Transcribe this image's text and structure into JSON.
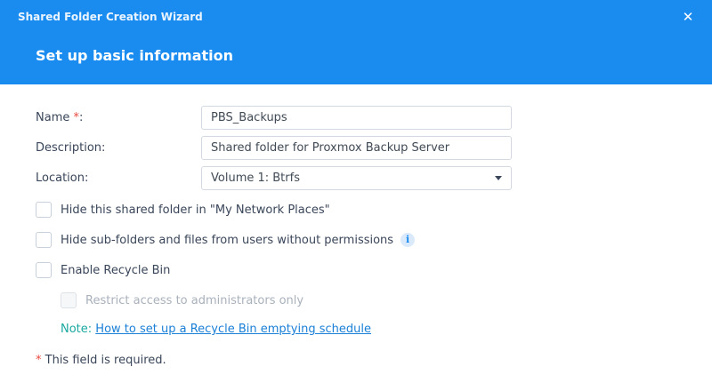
{
  "window": {
    "title": "Shared Folder Creation Wizard",
    "close_glyph": "✕"
  },
  "step": {
    "title": "Set up basic information"
  },
  "form": {
    "name": {
      "label": "Name ",
      "required_mark": "*",
      "suffix": ":",
      "value": "PBS_Backups"
    },
    "description": {
      "label": "Description:",
      "value": "Shared folder for Proxmox Backup Server"
    },
    "location": {
      "label": "Location:",
      "selected": "Volume 1:  Btrfs"
    }
  },
  "options": {
    "hide_folder": {
      "label": "Hide this shared folder in \"My Network Places\"",
      "checked": false
    },
    "hide_subfolders": {
      "label": "Hide sub-folders and files from users without permissions",
      "checked": false,
      "info_glyph": "i"
    },
    "recycle_bin": {
      "label": "Enable Recycle Bin",
      "checked": false
    },
    "restrict_admin": {
      "label": "Restrict access to administrators only",
      "checked": false,
      "disabled": true
    }
  },
  "note": {
    "prefix": "Note: ",
    "link_text": "How to set up a Recycle Bin emptying schedule"
  },
  "footer": {
    "required_mark": "*",
    "required_text": " This field is required."
  },
  "colors": {
    "header_bg": "#1a8cf0",
    "accent": "#1a8cf0",
    "required": "#e8493f",
    "note": "#1aa8a0",
    "link": "#1a7fd6"
  }
}
